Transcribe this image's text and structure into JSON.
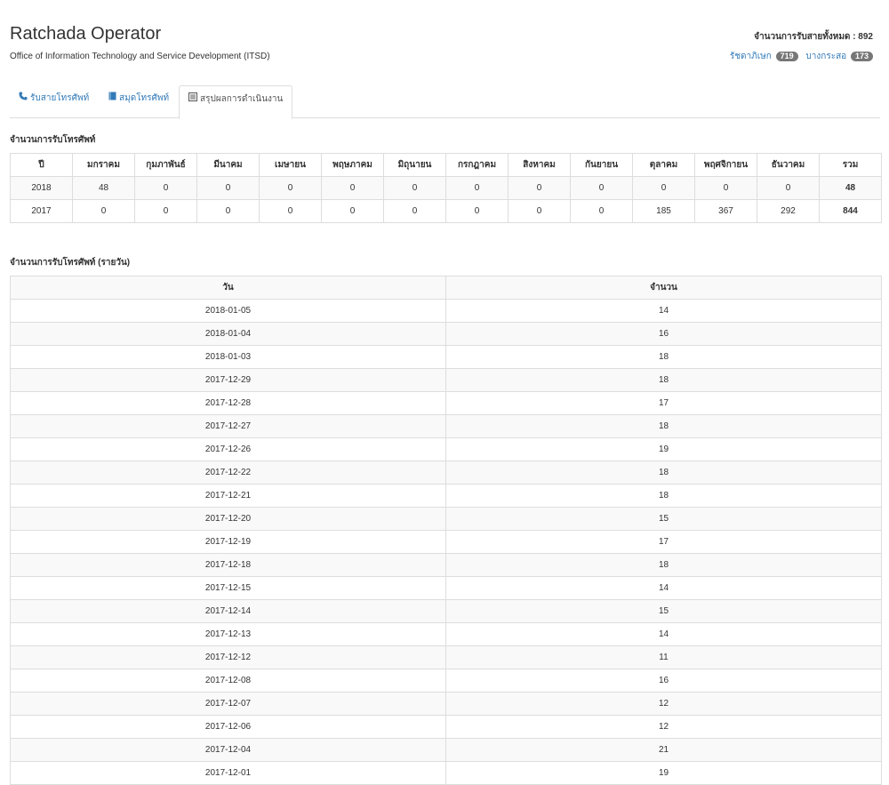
{
  "header": {
    "title": "Ratchada Operator",
    "subtitle": "Office of Information Technology and Service Development (ITSD)",
    "total_label": "จำนวนการรับสายทั้งหมด : 892",
    "sites": [
      {
        "label": "รัชดาภิเษก",
        "count": "719"
      },
      {
        "label": "บางกระสอ",
        "count": "173"
      }
    ]
  },
  "tabs": [
    {
      "label": "รับสายโทรศัพท์",
      "icon": "phone-icon"
    },
    {
      "label": "สมุดโทรศัพท์",
      "icon": "book-icon"
    },
    {
      "label": "สรุปผลการดำเนินงาน",
      "icon": "list-icon"
    }
  ],
  "monthly": {
    "title": "จำนวนการรับโทรศัพท์",
    "headers": [
      "ปี",
      "มกราคม",
      "กุมภาพันธ์",
      "มีนาคม",
      "เมษายน",
      "พฤษภาคม",
      "มิถุนายน",
      "กรกฎาคม",
      "สิงหาคม",
      "กันยายน",
      "ตุลาคม",
      "พฤศจิกายน",
      "ธันวาคม",
      "รวม"
    ],
    "rows": [
      [
        "2018",
        "48",
        "0",
        "0",
        "0",
        "0",
        "0",
        "0",
        "0",
        "0",
        "0",
        "0",
        "0",
        "48"
      ],
      [
        "2017",
        "0",
        "0",
        "0",
        "0",
        "0",
        "0",
        "0",
        "0",
        "0",
        "185",
        "367",
        "292",
        "844"
      ]
    ]
  },
  "daily": {
    "title": "จำนวนการรับโทรศัพท์ (รายวัน)",
    "headers": [
      "วัน",
      "จำนวน"
    ],
    "rows": [
      [
        "2018-01-05",
        "14"
      ],
      [
        "2018-01-04",
        "16"
      ],
      [
        "2018-01-03",
        "18"
      ],
      [
        "2017-12-29",
        "18"
      ],
      [
        "2017-12-28",
        "17"
      ],
      [
        "2017-12-27",
        "18"
      ],
      [
        "2017-12-26",
        "19"
      ],
      [
        "2017-12-22",
        "18"
      ],
      [
        "2017-12-21",
        "18"
      ],
      [
        "2017-12-20",
        "15"
      ],
      [
        "2017-12-19",
        "17"
      ],
      [
        "2017-12-18",
        "18"
      ],
      [
        "2017-12-15",
        "14"
      ],
      [
        "2017-12-14",
        "15"
      ],
      [
        "2017-12-13",
        "14"
      ],
      [
        "2017-12-12",
        "11"
      ],
      [
        "2017-12-08",
        "16"
      ],
      [
        "2017-12-07",
        "12"
      ],
      [
        "2017-12-06",
        "12"
      ],
      [
        "2017-12-04",
        "21"
      ],
      [
        "2017-12-01",
        "19"
      ]
    ]
  }
}
